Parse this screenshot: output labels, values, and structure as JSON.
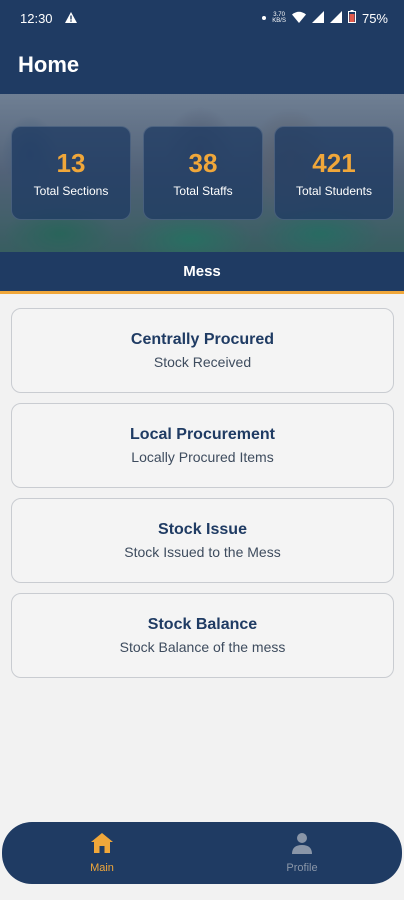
{
  "status_bar": {
    "time": "12:30",
    "data_speed_value": "3.70",
    "data_speed_unit": "KB/S",
    "battery": "75%"
  },
  "header": {
    "title": "Home"
  },
  "stats": [
    {
      "value": "13",
      "label": "Total Sections"
    },
    {
      "value": "38",
      "label": "Total Staffs"
    },
    {
      "value": "421",
      "label": "Total Students"
    }
  ],
  "section": {
    "title": "Mess"
  },
  "menu": [
    {
      "title": "Centrally Procured",
      "subtitle": "Stock Received"
    },
    {
      "title": "Local Procurement",
      "subtitle": "Locally Procured Items"
    },
    {
      "title": "Stock Issue",
      "subtitle": "Stock Issued to the Mess"
    },
    {
      "title": "Stock Balance",
      "subtitle": "Stock Balance of the mess"
    }
  ],
  "bottom_nav": {
    "items": [
      {
        "label": "Main",
        "icon": "home-icon",
        "active": true
      },
      {
        "label": "Profile",
        "icon": "person-icon",
        "active": false
      }
    ]
  },
  "colors": {
    "primary": "#1f3b63",
    "accent": "#f0a73a",
    "background": "#f2f2f2",
    "inactive_nav": "#8a96a8"
  }
}
